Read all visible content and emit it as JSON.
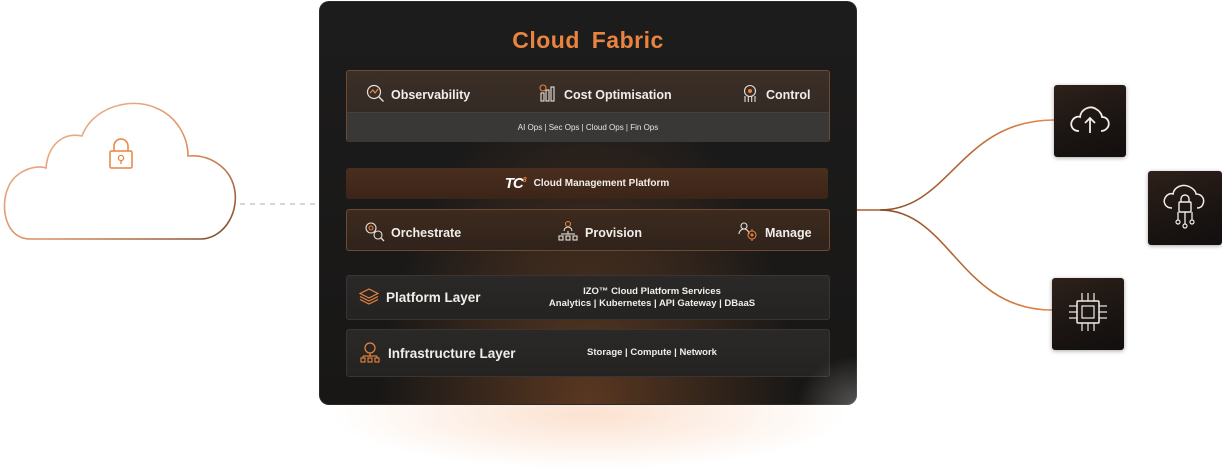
{
  "title": "Cloud  Fabric",
  "observability": {
    "items": [
      {
        "label": "Observability",
        "icon": "observability-icon"
      },
      {
        "label": "Cost Optimisation",
        "icon": "cost-optimisation-icon"
      },
      {
        "label": "Control",
        "icon": "control-icon"
      }
    ],
    "subtitle": "AI Ops | Sec Ops | Cloud Ops | Fin Ops"
  },
  "cmp": {
    "logo_text": "TC",
    "logo_mark": "8",
    "label": "Cloud Management Platform"
  },
  "operations": [
    {
      "label": "Orchestrate",
      "icon": "orchestrate-icon"
    },
    {
      "label": "Provision",
      "icon": "provision-icon"
    },
    {
      "label": "Manage",
      "icon": "manage-icon"
    }
  ],
  "platform_layer": {
    "title": "Platform Layer",
    "line1": "IZO™ Cloud Platform Services",
    "line2": "Analytics | Kubernetes | API Gateway | DBaaS"
  },
  "infrastructure_layer": {
    "title": "Infrastructure  Layer",
    "desc": "Storage | Compute | Network"
  },
  "colors": {
    "accent": "#e8843f",
    "panel_bg": "#1b1a19",
    "connector": "#c06a33"
  },
  "icons": [
    "lock-icon",
    "cloud-upload-icon",
    "cloud-security-icon",
    "chip-icon"
  ]
}
